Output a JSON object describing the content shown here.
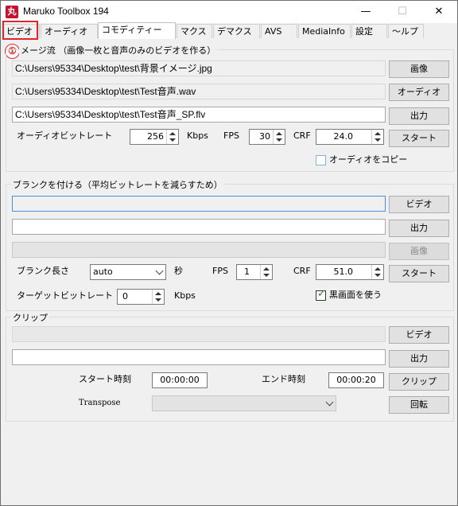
{
  "window": {
    "title": "Maruko Toolbox 194",
    "icon_text": "丸"
  },
  "titlebar": {
    "minimize": "—",
    "maximize": "☐",
    "close": "✕"
  },
  "tabs": [
    {
      "label": "ビデオ"
    },
    {
      "label": "オーディオ"
    },
    {
      "label": "コモディティー"
    },
    {
      "label": "マクス"
    },
    {
      "label": "デマクス"
    },
    {
      "label": "AVS"
    },
    {
      "label": "MediaInfo"
    },
    {
      "label": "設定"
    },
    {
      "label": "〜ルプ"
    }
  ],
  "annotation": {
    "badge": "①"
  },
  "image_stream": {
    "title": "メージ流 （画像一枚と音声のみのビデオを作る）",
    "image_path": "C:\\Users\\95334\\Desktop\\test\\背景イメージ.jpg",
    "audio_path": "C:\\Users\\95334\\Desktop\\test\\Test音声.wav",
    "output_path": "C:\\Users\\95334\\Desktop\\test\\Test音声_SP.flv",
    "image_button": "画像",
    "audio_button": "オーディオ",
    "output_button": "出力",
    "bitrate_label": "オーディオビットレート",
    "bitrate_value": "256",
    "bitrate_unit": "Kbps",
    "fps_label": "FPS",
    "fps_value": "30",
    "crf_label": "CRF",
    "crf_value": "24.0",
    "start_button": "スタート",
    "copy_audio_label": "オーディオをコピー"
  },
  "blank_add": {
    "title": "ブランクを付ける（平均ビットレートを減らすため）",
    "video_input": "",
    "output_input": "",
    "image_input": "",
    "video_button": "ビデオ",
    "output_button": "出力",
    "image_button": "画像",
    "blank_length_label": "ブランク長さ",
    "blank_length_value": "auto",
    "seconds_label": "秒",
    "fps_label": "FPS",
    "fps_value": "1",
    "crf_label": "CRF",
    "crf_value": "51.0",
    "start_button": "スタート",
    "target_bitrate_label": "ターゲットビットレート",
    "target_bitrate_value": "0",
    "target_bitrate_unit": "Kbps",
    "black_screen_label": "黒画面を使う"
  },
  "clip": {
    "title": "クリップ",
    "video_input": "",
    "output_input": "",
    "video_button": "ビデオ",
    "output_button": "出力",
    "start_time_label": "スタート時刻",
    "start_time_value": "00:00:00",
    "end_time_label": "エンド時刻",
    "end_time_value": "00:00:20",
    "clip_button": "クリップ",
    "transpose_label": "Transpose",
    "transpose_value": "",
    "rotate_button": "回転"
  }
}
